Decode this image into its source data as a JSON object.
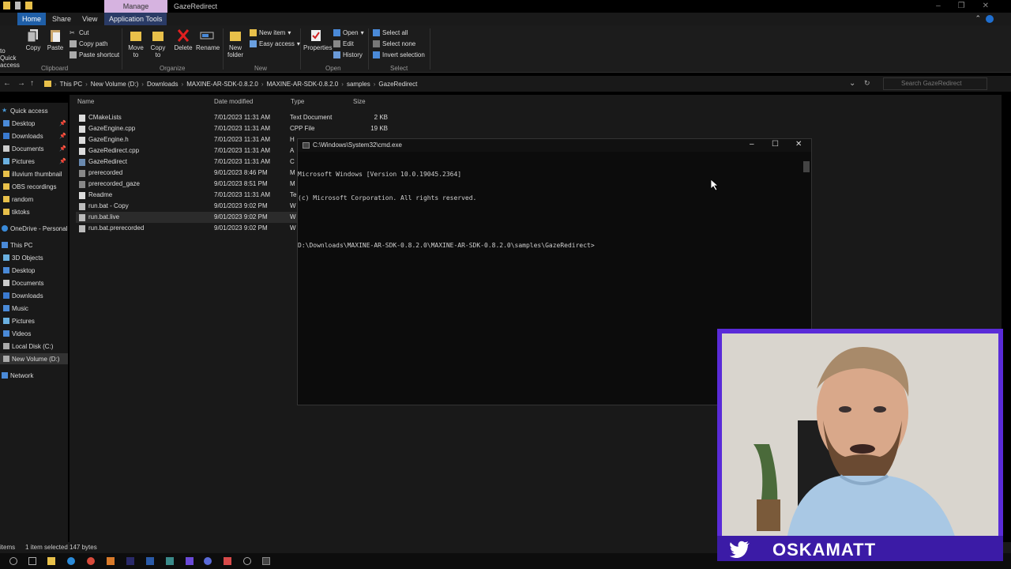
{
  "window": {
    "manage_tab": "Manage",
    "title": "GazeRedirect"
  },
  "ribbon_tabs": [
    "Home",
    "Share",
    "View",
    "Application Tools"
  ],
  "ribbon": {
    "pin_label": "to Quick access",
    "copy": "Copy",
    "paste": "Paste",
    "cut": "Cut",
    "copy_path": "Copy path",
    "paste_shortcut": "Paste shortcut",
    "move_to": "Move to",
    "copy_to": "Copy to",
    "delete": "Delete",
    "rename": "Rename",
    "new_folder": "New folder",
    "new_item": "New item",
    "easy_access": "Easy access",
    "properties": "Properties",
    "open": "Open",
    "edit": "Edit",
    "history": "History",
    "select_all": "Select all",
    "select_none": "Select none",
    "invert_selection": "Invert selection",
    "groups": {
      "clipboard": "Clipboard",
      "organize": "Organize",
      "new": "New",
      "open": "Open",
      "select": "Select"
    }
  },
  "address": {
    "crumbs": [
      "This PC",
      "New Volume (D:)",
      "Downloads",
      "MAXINE-AR-SDK-0.8.2.0",
      "MAXINE-AR-SDK-0.8.2.0",
      "samples",
      "GazeRedirect"
    ],
    "search_placeholder": "Search GazeRedirect"
  },
  "nav": {
    "quick_access": "Quick access",
    "desktop": "Desktop",
    "downloads": "Downloads",
    "documents": "Documents",
    "pictures": "Pictures",
    "illuvium": "illuvium thumbnail",
    "obs": "OBS recordings",
    "random": "random",
    "tiktoks": "tiktoks",
    "onedrive": "OneDrive - Personal",
    "this_pc": "This PC",
    "objects3d": "3D Objects",
    "desktop2": "Desktop",
    "documents2": "Documents",
    "downloads2": "Downloads",
    "music": "Music",
    "pictures2": "Pictures",
    "videos": "Videos",
    "local_disk": "Local Disk (C:)",
    "new_volume": "New Volume (D:)",
    "network": "Network"
  },
  "columns": {
    "name": "Name",
    "date": "Date modified",
    "type": "Type",
    "size": "Size"
  },
  "files": [
    {
      "name": "CMakeLists",
      "date": "7/01/2023 11:31 AM",
      "type": "Text Document",
      "size": "2 KB"
    },
    {
      "name": "GazeEngine.cpp",
      "date": "7/01/2023 11:31 AM",
      "type": "CPP File",
      "size": "19 KB"
    },
    {
      "name": "GazeEngine.h",
      "date": "7/01/2023 11:31 AM",
      "type": "H",
      "size": ""
    },
    {
      "name": "GazeRedirect.cpp",
      "date": "7/01/2023 11:31 AM",
      "type": "A",
      "size": ""
    },
    {
      "name": "GazeRedirect",
      "date": "7/01/2023 11:31 AM",
      "type": "C",
      "size": ""
    },
    {
      "name": "prerecorded",
      "date": "9/01/2023 8:46 PM",
      "type": "M",
      "size": ""
    },
    {
      "name": "prerecorded_gaze",
      "date": "9/01/2023 8:51 PM",
      "type": "M",
      "size": ""
    },
    {
      "name": "Readme",
      "date": "7/01/2023 11:31 AM",
      "type": "Te",
      "size": ""
    },
    {
      "name": "run.bat - Copy",
      "date": "9/01/2023 9:02 PM",
      "type": "W",
      "size": ""
    },
    {
      "name": "run.bat.live",
      "date": "9/01/2023 9:02 PM",
      "type": "W",
      "size": ""
    },
    {
      "name": "run.bat.prerecorded",
      "date": "9/01/2023 9:02 PM",
      "type": "W",
      "size": ""
    }
  ],
  "status": {
    "items": "items",
    "selected": "1 item selected  147 bytes"
  },
  "cmd": {
    "title": "C:\\Windows\\System32\\cmd.exe",
    "line1": "Microsoft Windows [Version 10.0.19045.2364]",
    "line2": "(c) Microsoft Corporation. All rights reserved.",
    "line3": "D:\\Downloads\\MAXINE-AR-SDK-0.8.2.0\\MAXINE-AR-SDK-0.8.2.0\\samples\\GazeRedirect>"
  },
  "webcam": {
    "handle": "OSKAMATT"
  },
  "colors": {
    "accent_tab": "#1f5fa8",
    "manage": "#d6b3e0",
    "webcam_frame": "#5a2bd8"
  }
}
